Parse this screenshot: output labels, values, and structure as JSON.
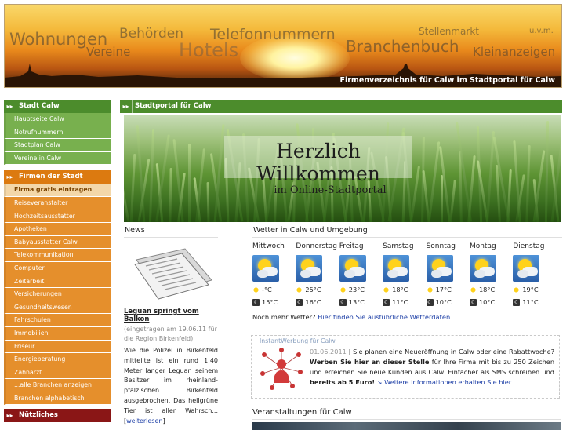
{
  "banner": {
    "keywords": [
      "Wohnungen",
      "Behörden",
      "Telefonnummern",
      "Vereine",
      "Hotels",
      "Branchenbuch",
      "Stellenmarkt",
      "u.v.m.",
      "Kleinanzeigen"
    ],
    "tagline": "Firmenverzeichnis für Calw im Stadtportal für Calw"
  },
  "nav": {
    "arrow": "▸▸",
    "stadt": {
      "title": "Stadt Calw",
      "items": [
        "Hauptseite Calw",
        "Notrufnummern",
        "Stadtplan Calw",
        "Vereine in Calw"
      ]
    },
    "firmen": {
      "title": "Firmen der Stadt",
      "items": [
        "Firma gratis eintragen",
        "Reiseveranstalter",
        "Hochzeitsausstatter",
        "Apotheken",
        "Babyausstatter Calw",
        "Telekommunikation",
        "Computer",
        "Zeitarbeit",
        "Versicherungen",
        "Gesundheitswesen",
        "Fahrschulen",
        "Immobilien",
        "Friseur",
        "Energieberatung",
        "Zahnarzt",
        "...alle Branchen anzeigen",
        "Branchen alphabetisch"
      ]
    },
    "nuetzliches": {
      "title": "Nützliches"
    }
  },
  "main": {
    "title": "Stadtportal für Calw",
    "hero": {
      "line1": "Herzlich Willkommen",
      "line2": "im Online-Stadtportal"
    }
  },
  "news": {
    "heading": "News",
    "title": "Leguan springt vom Balkon",
    "meta": "(eingetragen am 19.06.11 für die Region Birkenfeld)",
    "body": "Wie die Polizei in Birkenfeld mitteilte ist ein rund 1,40 Meter langer Leguan seinem Besitzer im rheinland-pfälzischen Birkenfeld ausgebrochen. Das hellgrüne Tier ist aller Wahrsch...",
    "more_open": "[",
    "more": "weiterlesen",
    "more_close": "]"
  },
  "weather": {
    "heading": "Wetter in Calw und Umgebung",
    "days": [
      {
        "name": "Mittwoch",
        "high": "-°C",
        "low": "15°C",
        "icon": "sun-cloud-icon"
      },
      {
        "name": "Donnerstag",
        "high": "25°C",
        "low": "16°C",
        "icon": "sun-cloud-icon"
      },
      {
        "name": "Freitag",
        "high": "23°C",
        "low": "13°C",
        "icon": "sun-cloud-icon"
      },
      {
        "name": "Samstag",
        "high": "18°C",
        "low": "11°C",
        "icon": "sun-cloud-icon"
      },
      {
        "name": "Sonntag",
        "high": "17°C",
        "low": "10°C",
        "icon": "sun-cloud-icon"
      },
      {
        "name": "Montag",
        "high": "18°C",
        "low": "10°C",
        "icon": "sun-cloud-icon"
      },
      {
        "name": "Dienstag",
        "high": "19°C",
        "low": "11°C",
        "icon": "sun-cloud-icon"
      }
    ],
    "more_text": "Noch mehr Wetter?",
    "more_link": "Hier finden Sie ausführliche Wetterdaten."
  },
  "instant": {
    "label": "InstantWerbung für Calw",
    "date": "01.06.2011",
    "sep": " | ",
    "t1": "Sie planen eine Neueröffnung in Calw oder eine Rabattwoche?",
    "t2": " Werben Sie hier an dieser Stelle",
    "t3": " für Ihre Firma mit bis zu 250 Zeichen und erreichen Sie neue Kunden aus Calw. Einfacher als SMS schreiben und ",
    "t4": "bereits ab 5 Euro!",
    "link_arrow": " ↘ ",
    "link": "Weitere Informationen erhalten Sie hier."
  },
  "events": {
    "heading": "Veranstaltungen für Calw"
  },
  "colors": {
    "green": "#4c8c2c",
    "orange": "#dc7a10",
    "darkred": "#8a1616",
    "link": "#1c3ea6"
  }
}
